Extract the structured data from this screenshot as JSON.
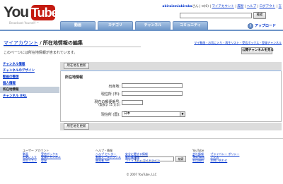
{
  "logo": {
    "you": "You",
    "tube": "Tube",
    "tagline": "Broadcast Yourself ™"
  },
  "header": {
    "username": "akiraizmiakiraka",
    "username_suffix": "さん",
    "links": [
      "(0)",
      "マイアカウント",
      "履歴",
      "ヘルプ",
      "ログアウト",
      "言"
    ],
    "search_button": "検索"
  },
  "nav": {
    "tabs": [
      "動画",
      "カテゴリ",
      "チャンネル",
      "コミュニティ"
    ],
    "upload": "アップロード"
  },
  "page": {
    "breadcrumb": "マイアカウント",
    "separator": "/",
    "title": "所在地情報の編集",
    "sublinks": "マイ動画 - お気に入り - 再生リスト - 受信ボックス - 登録チャンネル",
    "description": "このページには所在地情報が含まれています。",
    "public_channel_button": "公開チャンネルを見る"
  },
  "sidebar": {
    "items": [
      {
        "label": "チャンネル情報",
        "active": false
      },
      {
        "label": "チャンネルのデザイン",
        "active": false
      },
      {
        "label": "動画の整理",
        "active": false
      },
      {
        "label": "個人情報",
        "active": false
      },
      {
        "label": "所在地情報",
        "active": true
      },
      {
        "label": "チャンネル URL",
        "active": false
      }
    ]
  },
  "form": {
    "update_button": "所在地を更新",
    "section_title": "所在地情報",
    "hometown_label": "出身地:",
    "city_label": "現住所 (市):",
    "zip_label_1": "現在の郵便番号:",
    "zip_label_2": "(英数字 11 文字)",
    "country_label": "現住所 (国):",
    "country_value": "日本"
  },
  "footer": {
    "search_button": "検索",
    "col1_head": "ユーザー アカウント",
    "col1_links": [
      "動画",
      "お気に入り",
      "再生リスト",
      "受信ボックス",
      "登録チャンネル",
      "登録"
    ],
    "col2_head": "ヘルプ・情報",
    "col2_links": [
      "ヘルプ センター",
      "動画ツールボックス",
      "開発者 API",
      "安全に関する情報",
      "著作権情報",
      "コミュニティ ガイドライン"
    ],
    "col3_head": "YouTube",
    "col3_links": [
      "会社情報",
      "TestTube",
      "利用規約",
      "プライバシー ポリシー",
      "プレス",
      "お問い合わせ"
    ],
    "copyright": "© 2007 YouTube, LLC"
  }
}
